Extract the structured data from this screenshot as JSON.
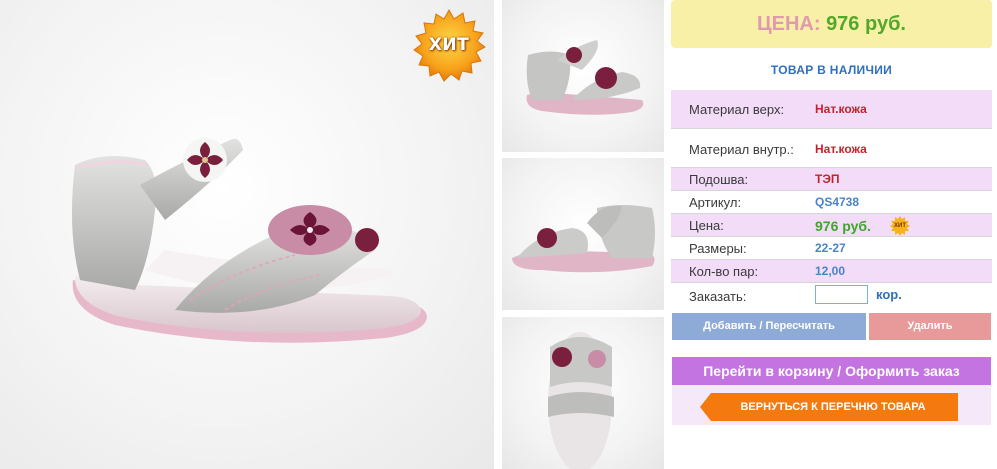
{
  "badge": {
    "hit_label": "ХИТ"
  },
  "price_header": {
    "label": "ЦЕНА:",
    "value": "976 руб."
  },
  "stock_status": "ТОВАР В НАЛИЧИИ",
  "specs": {
    "material_top": {
      "label": "Материал верх:",
      "value": "Нат.кожа"
    },
    "material_inner": {
      "label": "Материал внутр.:",
      "value": "Нат.кожа"
    },
    "sole": {
      "label": "Подошва:",
      "value": "ТЭП"
    },
    "article": {
      "label": "Артикул:",
      "value": "QS4738"
    },
    "price": {
      "label": "Цена:",
      "value": "976 руб.",
      "badge": "ХИТ"
    },
    "sizes": {
      "label": "Размеры:",
      "value": "22-27"
    },
    "pairs": {
      "label": "Кол-во пар:",
      "value": "12,00"
    },
    "order": {
      "label": "Заказать:",
      "quantity_value": "",
      "unit": "кор."
    }
  },
  "buttons": {
    "add_recalc": "Добавить / Пересчитать",
    "delete": "Удалить",
    "go_to_cart": "Перейти в корзину / Оформить заказ",
    "back_to_list": "ВЕРНУТЬСЯ К ПЕРЕЧНЮ ТОВАРА"
  },
  "colors": {
    "price_bg": "#f9f0a8",
    "price_label": "#e09aae",
    "price_value": "#52a82a",
    "row_pink": "#f2dcf8",
    "add_button": "#8eaad6",
    "delete_button": "#e89a9a",
    "cart_button": "#c374e0",
    "back_button": "#f47a10"
  }
}
